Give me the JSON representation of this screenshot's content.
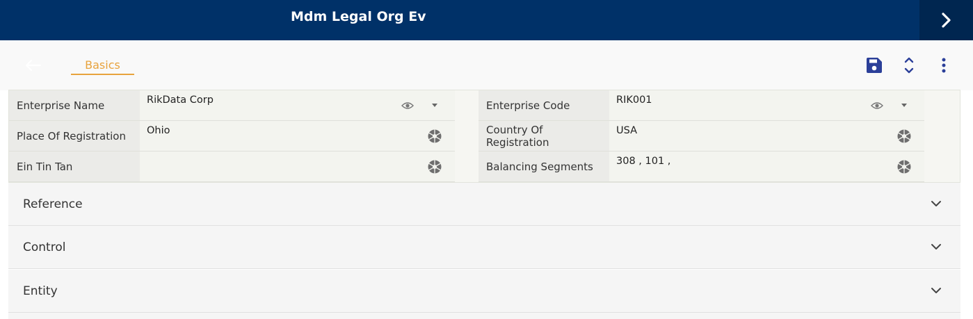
{
  "header": {
    "title": "Mdm Legal Org Ev",
    "next_icon": "chevron-right-icon"
  },
  "toolbar": {
    "back_icon": "arrow-left-icon",
    "tab_label": "Basics",
    "save_icon": "floppy-disk-icon",
    "collapse_icon": "unfold-less-icon",
    "more_icon": "kebab-menu-icon"
  },
  "form": {
    "enterprise_name": {
      "label": "Enterprise Name",
      "value": "RikData Corp"
    },
    "enterprise_code": {
      "label": "Enterprise Code",
      "value": "RIK001"
    },
    "place_of_registration": {
      "label": "Place Of Registration",
      "value": "Ohio"
    },
    "country_of_registration": {
      "label_line1": "Country Of",
      "label_line2": "Registration",
      "value": "USA"
    },
    "ein_tin_tan": {
      "label": "Ein Tin Tan",
      "value": ""
    },
    "balancing_segments": {
      "label": "Balancing Segments",
      "value": "308 , 101 ,"
    }
  },
  "sections": [
    {
      "label": "Reference"
    },
    {
      "label": "Control"
    },
    {
      "label": "Entity"
    }
  ],
  "colors": {
    "header_bg": "#003168",
    "accent": "#e8a33d",
    "icon_blue": "#2b3f99"
  }
}
